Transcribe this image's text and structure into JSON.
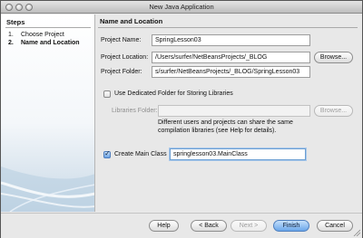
{
  "window": {
    "title": "New Java Application"
  },
  "steps": {
    "title": "Steps",
    "items": [
      {
        "num": "1.",
        "label": "Choose Project",
        "current": false
      },
      {
        "num": "2.",
        "label": "Name and Location",
        "current": true
      }
    ]
  },
  "panel": {
    "header": "Name and Location",
    "project_name": {
      "label": "Project Name:",
      "value": "SpringLesson03"
    },
    "project_location": {
      "label": "Project Location:",
      "value": "/Users/surfer/NetBeansProjects/_BLOG",
      "browse": "Browse..."
    },
    "project_folder": {
      "label": "Project Folder:",
      "value": "s/surfer/NetBeansProjects/_BLOG/SpringLesson03"
    },
    "dedicated_folder": {
      "label": "Use Dedicated Folder for Storing Libraries",
      "checked": false
    },
    "libraries_folder": {
      "label": "Libraries Folder:",
      "value": "",
      "browse": "Browse...",
      "enabled": false
    },
    "libraries_note": {
      "line1": "Different users and projects can share the same",
      "line2": "compilation libraries (see Help for details)."
    },
    "main_class": {
      "label": "Create Main Class",
      "checked": true,
      "value": "springlesson03.MainClass"
    }
  },
  "buttons": {
    "help": "Help",
    "back": "< Back",
    "next": "Next >",
    "finish": "Finish",
    "cancel": "Cancel"
  }
}
